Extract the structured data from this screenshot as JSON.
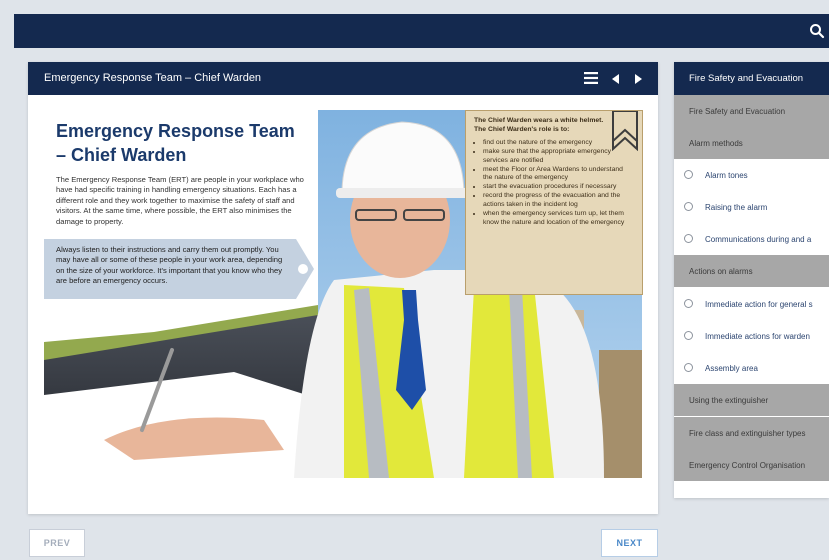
{
  "topbar": {
    "search_icon": "search-icon"
  },
  "lesson": {
    "header_title": "Emergency Response Team – Chief Warden",
    "heading": "Emergency Response Team – Chief Warden",
    "intro": "The Emergency Response Team (ERT) are people in your workplace who have had specific training in handling emergency situations. Each has a different role and they work together to maximise the safety of staff and visitors. At the same time, where possible, the ERT also minimises the damage to property.",
    "callout": "Always listen to their instructions and carry them out promptly. You may have all or some of these people in your work area, depending on the size of your workforce. It's important that you know who they are before an emergency occurs.",
    "info_lead": "The Chief Warden wears a white helmet. The Chief Warden's role is to:",
    "info_items": [
      "find out the nature of the emergency",
      "make sure that the appropriate emergency services are notified",
      "meet the Floor or Area Wardens to understand the nature of the emergency",
      "start the evacuation procedures if necessary",
      "record the progress of the evacuation and the actions taken in the incident log",
      "when the emergency services turn up, let them know the nature and location of the emergency"
    ]
  },
  "nav": {
    "prev_label": "PREV",
    "next_label": "NEXT"
  },
  "sidebar": {
    "title": "Fire Safety and Evacuation",
    "items": [
      {
        "label": "Fire Safety and Evacuation",
        "type": "section"
      },
      {
        "label": "Alarm methods",
        "type": "section"
      },
      {
        "label": "Alarm tones",
        "type": "sub"
      },
      {
        "label": "Raising the alarm",
        "type": "sub"
      },
      {
        "label": "Communications during and a",
        "type": "sub"
      },
      {
        "label": "Actions on alarms",
        "type": "section"
      },
      {
        "label": "Immediate action for general s",
        "type": "sub"
      },
      {
        "label": "Immediate actions for warden",
        "type": "sub"
      },
      {
        "label": "Assembly area",
        "type": "sub"
      },
      {
        "label": "Using the extinguisher",
        "type": "section"
      },
      {
        "label": "Fire class and extinguisher types",
        "type": "section"
      },
      {
        "label": "Emergency Control Organisation",
        "type": "section"
      }
    ]
  },
  "colors": {
    "navy": "#14294f",
    "heading_blue": "#1b3a6b",
    "callout_blue": "#c4d1e0",
    "parchment": "#e6d8b9",
    "section_grey": "#a7a7a7"
  }
}
